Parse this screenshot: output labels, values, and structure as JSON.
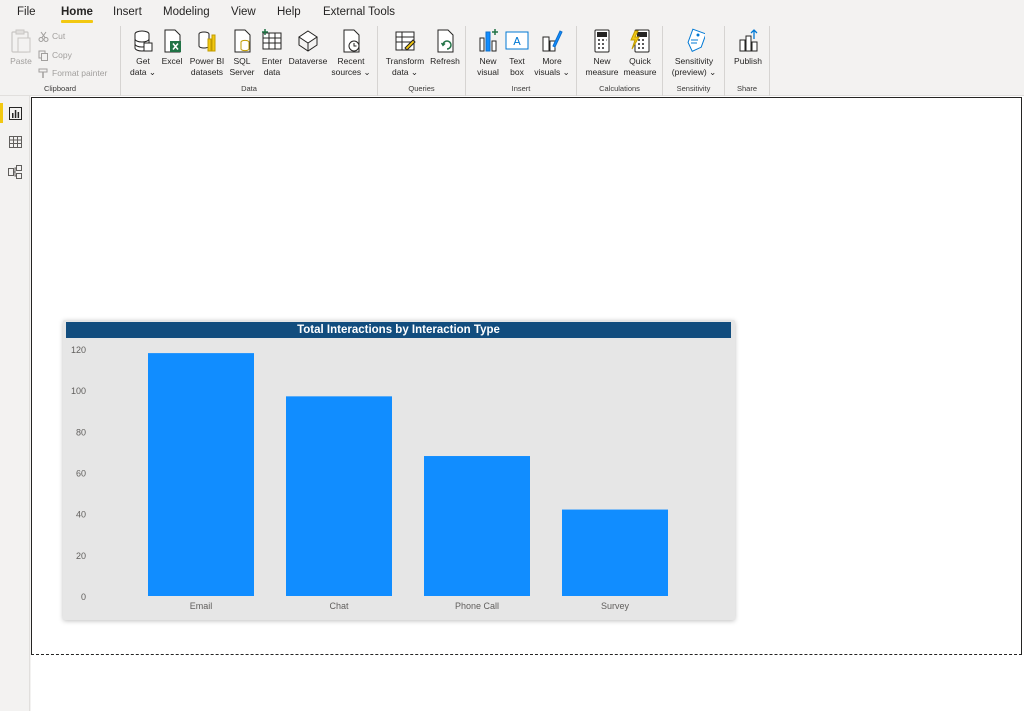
{
  "menu": {
    "items": [
      "File",
      "Home",
      "Insert",
      "Modeling",
      "View",
      "Help",
      "External Tools"
    ],
    "active": "Home"
  },
  "ribbon": {
    "clipboard": {
      "label": "Clipboard",
      "paste": "Paste",
      "cut": "Cut",
      "copy": "Copy",
      "format_painter": "Format painter"
    },
    "data": {
      "label": "Data",
      "get_data": [
        "Get",
        "data"
      ],
      "excel": "Excel",
      "power_bi": [
        "Power BI",
        "datasets"
      ],
      "sql": [
        "SQL",
        "Server"
      ],
      "enter": [
        "Enter",
        "data"
      ],
      "dataverse": "Dataverse",
      "recent": [
        "Recent",
        "sources"
      ]
    },
    "queries": {
      "label": "Queries",
      "transform": [
        "Transform",
        "data"
      ],
      "refresh": "Refresh"
    },
    "insert": {
      "label": "Insert",
      "new_visual": [
        "New",
        "visual"
      ],
      "text_box": [
        "Text",
        "box"
      ],
      "more_visuals": [
        "More",
        "visuals"
      ]
    },
    "calculations": {
      "label": "Calculations",
      "new_measure": [
        "New",
        "measure"
      ],
      "quick_measure": [
        "Quick",
        "measure"
      ]
    },
    "sensitivity": {
      "label": "Sensitivity",
      "btn": [
        "Sensitivity",
        "(preview)"
      ]
    },
    "share": {
      "label": "Share",
      "publish": "Publish"
    }
  },
  "colors": {
    "accent": "#f2c811",
    "title_bg": "#124d7e",
    "bar": "#118dff"
  },
  "chart_data": {
    "type": "bar",
    "title": "Total Interactions by Interaction Type",
    "categories": [
      "Email",
      "Chat",
      "Phone Call",
      "Survey"
    ],
    "values": [
      118,
      97,
      68,
      42
    ],
    "yticks": [
      0,
      20,
      40,
      60,
      80,
      100,
      120
    ],
    "ylim": [
      0,
      120
    ],
    "xlabel": "",
    "ylabel": "",
    "grid": false
  }
}
